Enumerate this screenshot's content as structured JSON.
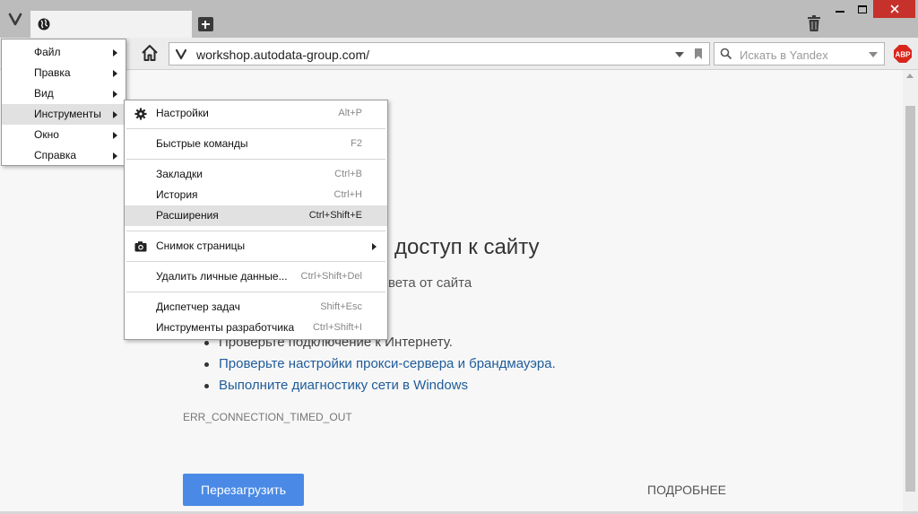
{
  "tab": {
    "title": ""
  },
  "address_bar": {
    "url": "workshop.autodata-group.com/"
  },
  "search_bar": {
    "placeholder": "Искать в Yandex"
  },
  "addon": {
    "label": "ABP"
  },
  "main_menu": {
    "items": [
      {
        "label": "Файл"
      },
      {
        "label": "Правка"
      },
      {
        "label": "Вид"
      },
      {
        "label": "Инструменты"
      },
      {
        "label": "Окно"
      },
      {
        "label": "Справка"
      }
    ]
  },
  "tools_menu": {
    "items": [
      {
        "label": "Настройки",
        "shortcut": "Alt+P"
      },
      {
        "label": "Быстрые команды",
        "shortcut": "F2"
      },
      {
        "label": "Закладки",
        "shortcut": "Ctrl+B"
      },
      {
        "label": "История",
        "shortcut": "Ctrl+H"
      },
      {
        "label": "Расширения",
        "shortcut": "Ctrl+Shift+E"
      },
      {
        "label": "Снимок страницы",
        "shortcut": ""
      },
      {
        "label": "Удалить личные данные...",
        "shortcut": "Ctrl+Shift+Del"
      },
      {
        "label": "Диспетчер задач",
        "shortcut": "Shift+Esc"
      },
      {
        "label": "Инструменты разработчика",
        "shortcut": "Ctrl+Shift+I"
      }
    ]
  },
  "error_page": {
    "headline": "доступ к сайту",
    "subtext": "вета от сайта",
    "suggestions": [
      "Проверьте подключение к Интернету.",
      "Проверьте настройки прокси-сервера и брандмауэра.",
      "Выполните диагностику сети в Windows"
    ],
    "error_code": "ERR_CONNECTION_TIMED_OUT",
    "reload_button": "Перезагрузить",
    "details_link": "ПОДРОБНЕЕ"
  },
  "colors": {
    "link": "#1f5c9a",
    "primary_button": "#4a8ae6",
    "close_button": "#c7312b",
    "abp_red": "#d9261c"
  }
}
